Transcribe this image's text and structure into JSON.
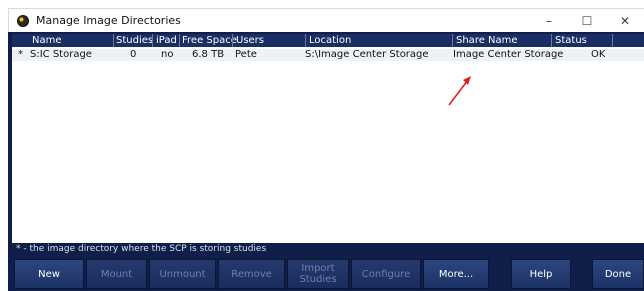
{
  "window": {
    "title": "Manage Image Directories",
    "controls": {
      "minimize": "–",
      "maximize": "☐",
      "close": "✕"
    }
  },
  "table": {
    "columns": [
      "Name",
      "Studies",
      "iPad",
      "Free Space",
      "Users",
      "Location",
      "Share Name",
      "Status"
    ],
    "rows": [
      {
        "marker": "*",
        "name": "S:IC Storage",
        "studies": "0",
        "ipad": "no",
        "free_space": "6.8 TB",
        "users": "Pete",
        "location": "S:\\Image Center Storage",
        "share_name": "Image Center Storage",
        "status": "OK"
      }
    ]
  },
  "footer_note": "* - the image directory where the SCP is storing studies",
  "buttons": {
    "new": "New",
    "mount": "Mount",
    "unmount": "Unmount",
    "remove": "Remove",
    "import_studies": "Import Studies",
    "configure": "Configure",
    "more": "More...",
    "help": "Help",
    "done": "Done"
  },
  "colors": {
    "panel_bg": "#0f1f4a",
    "header_bg": "#1b2e63",
    "button_bg": "#2c467f",
    "disabled_text": "#6f7fa8",
    "annotation_arrow": "#e02020"
  },
  "icons": {
    "app": "app-icon",
    "annotation": "red-arrow-icon"
  }
}
